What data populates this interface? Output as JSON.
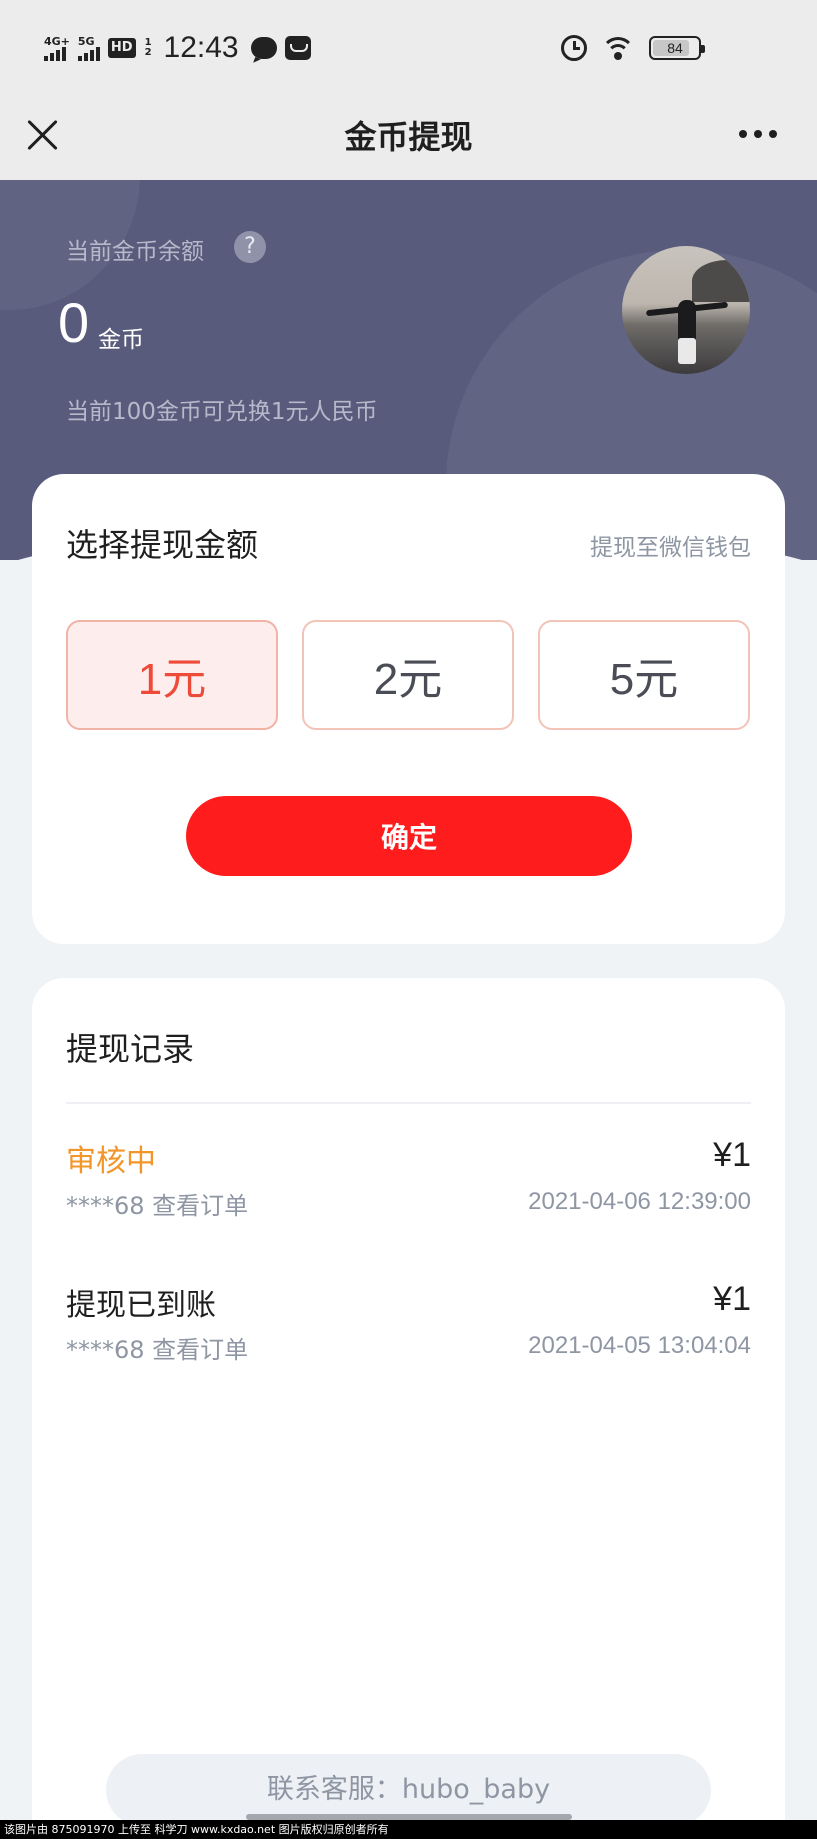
{
  "status_bar": {
    "net1": "4G+",
    "net2": "5G",
    "hd": "HD",
    "hd_sub_top": "1",
    "hd_sub_bottom": "2",
    "time": "12:43",
    "battery": "84",
    "battery_level": 0.84
  },
  "nav": {
    "title": "金币提现"
  },
  "balance": {
    "label": "当前金币余额",
    "help": "?",
    "value": "0",
    "unit": "金币",
    "rate_text": "当前100金币可兑换1元人民币"
  },
  "select": {
    "title": "选择提现金额",
    "destination": "提现至微信钱包",
    "options": [
      "1元",
      "2元",
      "5元"
    ],
    "selected_index": 0,
    "confirm_label": "确定"
  },
  "records": {
    "title": "提现记录",
    "items": [
      {
        "status": "审核中",
        "amount": "¥1",
        "sub": "****68 查看订单",
        "time": "2021-04-06 12:39:00"
      },
      {
        "status": "提现已到账",
        "amount": "¥1",
        "sub": "****68 查看订单",
        "time": "2021-04-05 13:04:04"
      }
    ]
  },
  "contact": "联系客服：hubo_baby",
  "watermark": "该图片由 875091970 上传至 科学刀 www.kxdao.net 图片版权归原创者所有",
  "colors": {
    "accent_red": "#fe1c1c",
    "hero_bg": "#585b7b",
    "pending": "#f2962a"
  }
}
